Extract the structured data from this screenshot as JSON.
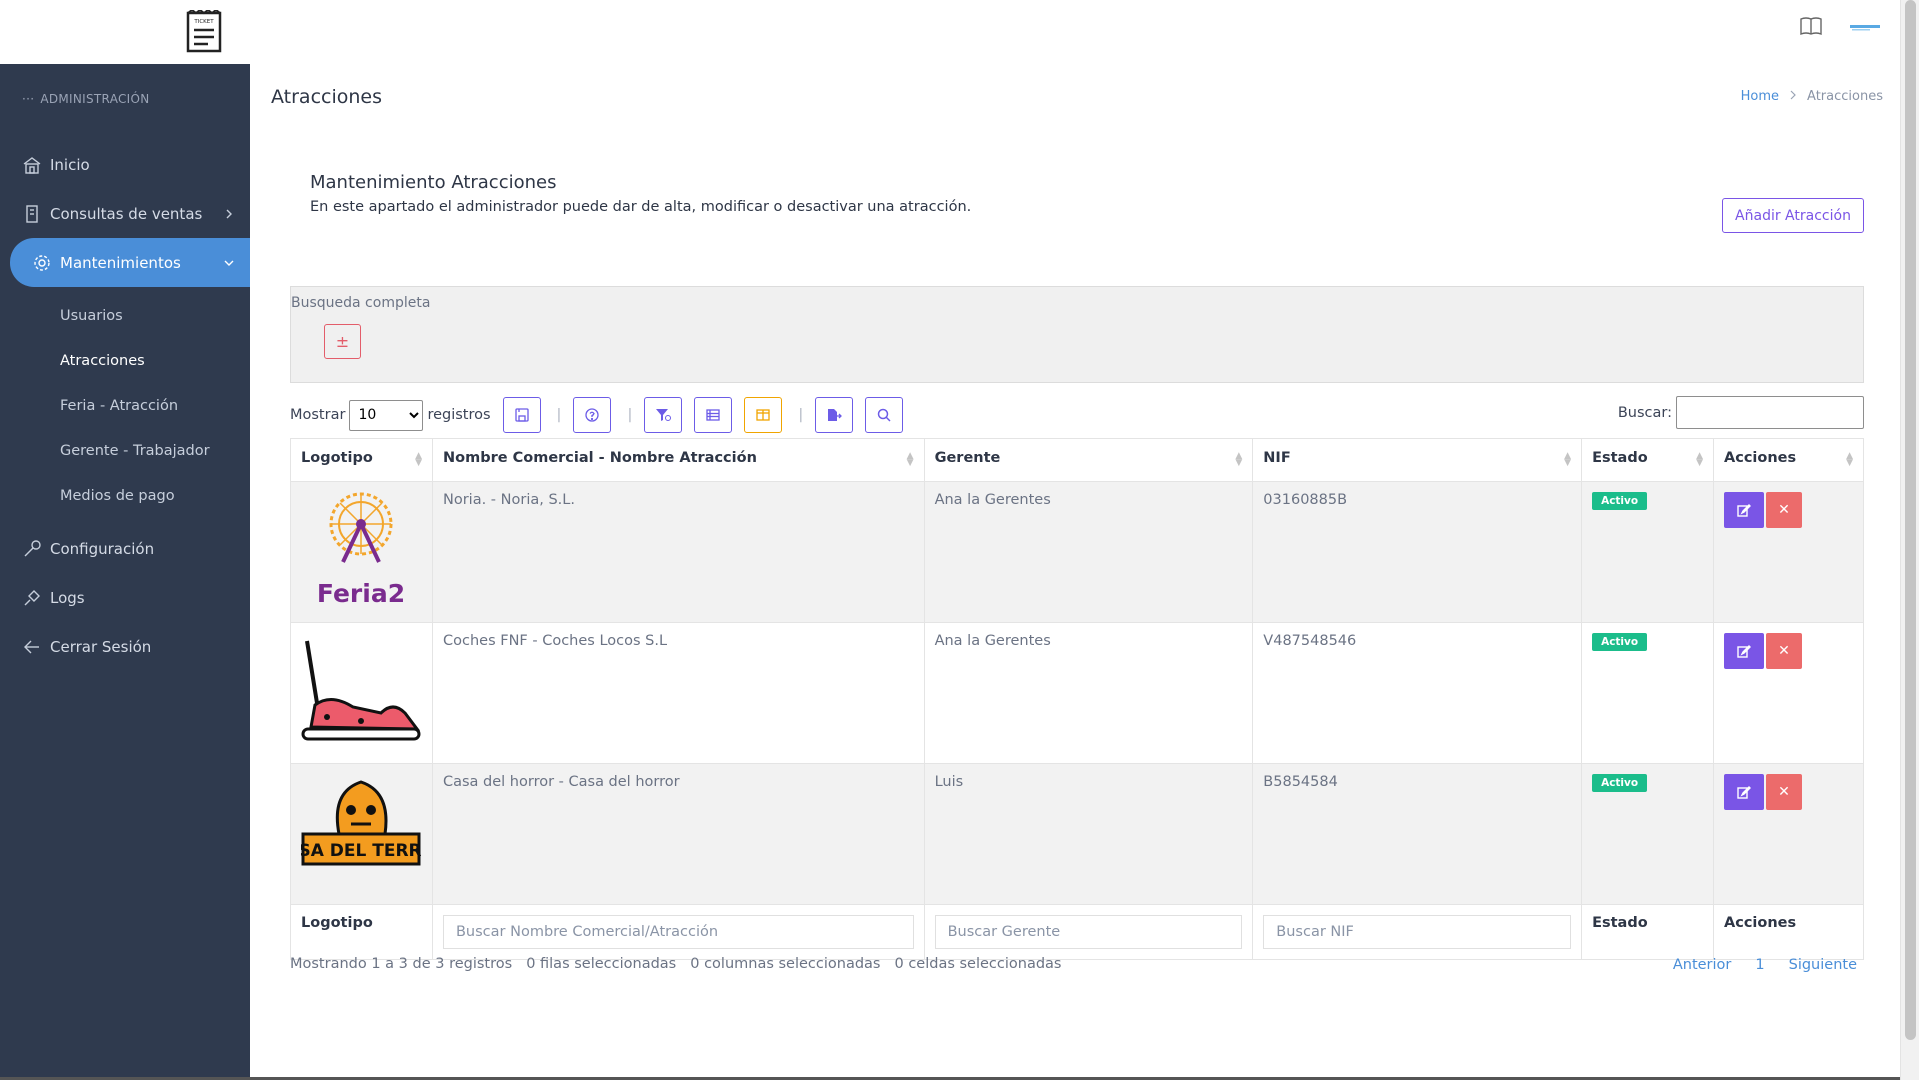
{
  "brand": {
    "logo_text": "TICKET"
  },
  "sidebar": {
    "section_title": "ADMINISTRACIÓN",
    "items": [
      {
        "label": "Inicio",
        "icon": "home-icon"
      },
      {
        "label": "Consultas de ventas",
        "icon": "receipt-icon"
      },
      {
        "label": "Mantenimientos",
        "icon": "gear-icon",
        "active": true,
        "children": [
          "Usuarios",
          "Atracciones",
          "Feria - Atracción",
          "Gerente - Trabajador",
          "Medios de pago"
        ]
      },
      {
        "label": "Configuración",
        "icon": "wrench-icon"
      },
      {
        "label": "Logs",
        "icon": "pin-icon"
      },
      {
        "label": "Cerrar Sesión",
        "icon": "logout-icon"
      }
    ]
  },
  "header": {
    "title": "Atracciones",
    "breadcrumb": [
      "Home",
      "Atracciones"
    ]
  },
  "card": {
    "title": "Mantenimiento Atracciones",
    "description": "En este apartado el administrador puede dar de alta, modificar o desactivar una atracción.",
    "add_button": "Añadir Atracción"
  },
  "search_panel": {
    "label": "Busqueda completa",
    "toggle": "±"
  },
  "controls": {
    "show_label": "Mostrar",
    "page_size": "10",
    "page_size_options": [
      "10"
    ],
    "records_label": "registros",
    "search_label": "Buscar:"
  },
  "table": {
    "columns": [
      "Logotipo",
      "Nombre Comercial - Nombre Atracción",
      "Gerente",
      "NIF",
      "Estado",
      "Acciones"
    ],
    "rows": [
      {
        "logo": "Feria2",
        "name": "Noria. - Noria, S.L.",
        "manager": "Ana la Gerentes",
        "nif": "03160885B",
        "status": "Activo"
      },
      {
        "logo": "bumper-car",
        "name": "Coches FNF - Coches Locos S.L",
        "manager": "Ana la Gerentes",
        "nif": "V487548546",
        "status": "Activo"
      },
      {
        "logo": "CASA DEL TERROR",
        "name": "Casa del horror - Casa del horror",
        "manager": "Luis",
        "nif": "B5854584",
        "status": "Activo"
      }
    ],
    "footer": {
      "logo": "Logotipo",
      "name_placeholder": "Buscar Nombre Comercial/Atracción",
      "manager_placeholder": "Buscar Gerente",
      "nif_placeholder": "Buscar NIF",
      "status": "Estado",
      "actions": "Acciones"
    }
  },
  "info": {
    "showing": "Mostrando 1 a 3 de 3 registros",
    "rows_selected": "0 filas seleccionadas",
    "cols_selected": "0 columnas seleccionadas",
    "cells_selected": "0 celdas seleccionadas"
  },
  "pagination": {
    "prev": "Anterior",
    "page": "1",
    "next": "Siguiente"
  },
  "colors": {
    "sidebar": "#2f3a4e",
    "active": "#4a8ed8",
    "primary": "#7a55e6",
    "danger": "#ec6b6b",
    "success": "#1bbd8b"
  }
}
